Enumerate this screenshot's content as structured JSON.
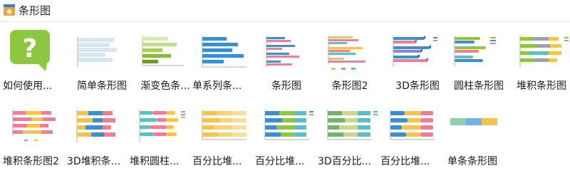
{
  "header": {
    "title": "条形图",
    "icon": "chart-category-icon"
  },
  "colors": {
    "green": "#8dc63f",
    "blue": "#3b8fd1",
    "pink": "#f07d95",
    "yellow": "#f5c34a",
    "teal": "#5bc0c4",
    "gray": "#9a9a9a"
  },
  "templates": [
    {
      "label": "如何使用...",
      "icon": "help-question-icon"
    },
    {
      "label": "简单条形图",
      "icon": "simple-bar-chart-icon"
    },
    {
      "label": "渐变色条...",
      "icon": "gradient-bar-chart-icon"
    },
    {
      "label": "单系列条...",
      "icon": "single-series-bar-chart-icon"
    },
    {
      "label": "条形图",
      "icon": "bar-chart-icon"
    },
    {
      "label": "条形图2",
      "icon": "bar-chart-2-icon"
    },
    {
      "label": "3D条形图",
      "icon": "3d-bar-chart-icon"
    },
    {
      "label": "圆柱条形图",
      "icon": "cylinder-bar-chart-icon"
    },
    {
      "label": "堆积条形图",
      "icon": "stacked-bar-chart-icon"
    },
    {
      "label": "堆积条形图2",
      "icon": "stacked-bar-chart-2-icon"
    },
    {
      "label": "3D堆积条...",
      "icon": "3d-stacked-bar-chart-icon"
    },
    {
      "label": "堆积圆柱...",
      "icon": "stacked-cylinder-bar-chart-icon"
    },
    {
      "label": "百分比堆...",
      "icon": "percent-stacked-bar-chart-icon"
    },
    {
      "label": "百分比堆...",
      "icon": "percent-stacked-bar-chart-2-icon"
    },
    {
      "label": "3D百分比...",
      "icon": "3d-percent-stacked-bar-chart-icon"
    },
    {
      "label": "百分比堆...",
      "icon": "percent-stacked-cylinder-bar-chart-icon"
    },
    {
      "label": "单条条形图",
      "icon": "single-bar-chart-icon"
    }
  ]
}
